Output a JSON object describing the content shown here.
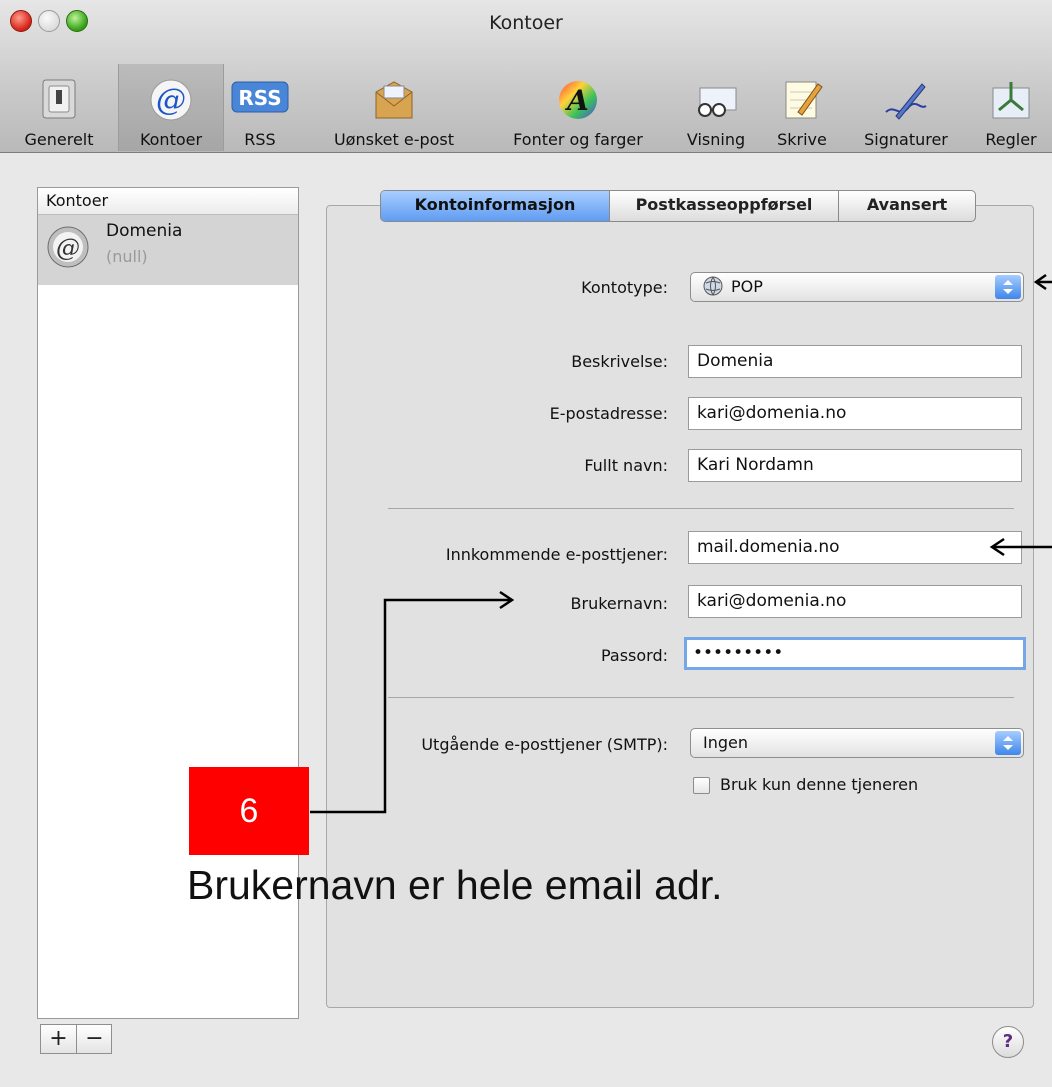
{
  "window": {
    "title": "Kontoer"
  },
  "toolbar": {
    "items": [
      {
        "label": "Generelt",
        "icon": "switch-icon"
      },
      {
        "label": "Kontoer",
        "icon": "at-sign-icon",
        "selected": true
      },
      {
        "label": "RSS",
        "icon": "rss-icon"
      },
      {
        "label": "Uønsket e-post",
        "icon": "junk-mail-icon"
      },
      {
        "label": "Fonter og farger",
        "icon": "font-colors-icon"
      },
      {
        "label": "Visning",
        "icon": "glasses-icon"
      },
      {
        "label": "Skrive",
        "icon": "pencil-note-icon"
      },
      {
        "label": "Signaturer",
        "icon": "pen-signature-icon"
      },
      {
        "label": "Regler",
        "icon": "rules-icon"
      }
    ]
  },
  "accounts": {
    "header": "Kontoer",
    "items": [
      {
        "name": "Domenia",
        "sub": "(null)"
      }
    ]
  },
  "tabs": [
    {
      "label": "Kontoinformasjon",
      "active": true
    },
    {
      "label": "Postkasseoppførsel"
    },
    {
      "label": "Avansert"
    }
  ],
  "form": {
    "account_type_label": "Kontotype:",
    "account_type_value": "POP",
    "description_label": "Beskrivelse:",
    "description_value": "Domenia",
    "email_label": "E-postadresse:",
    "email_value": "kari@domenia.no",
    "fullname_label": "Fullt navn:",
    "fullname_value": "Kari Nordamn",
    "incoming_label": "Innkommende e-posttjener:",
    "incoming_value": "mail.domenia.no",
    "username_label": "Brukernavn:",
    "username_value": "kari@domenia.no",
    "password_label": "Passord:",
    "password_value": "•••••••••",
    "smtp_label": "Utgående e-posttjener (SMTP):",
    "smtp_value": "Ingen",
    "only_server_label": "Bruk kun denne tjeneren",
    "only_server_checked": false
  },
  "buttons": {
    "add": "+",
    "remove": "−",
    "help": "?"
  },
  "annotation": {
    "step": "6",
    "caption": "Brukernavn er hele email adr."
  },
  "colors": {
    "step_badge": "#ff0000",
    "tab_active": "#5f9cf1",
    "focus_ring": "#74a7e8"
  }
}
